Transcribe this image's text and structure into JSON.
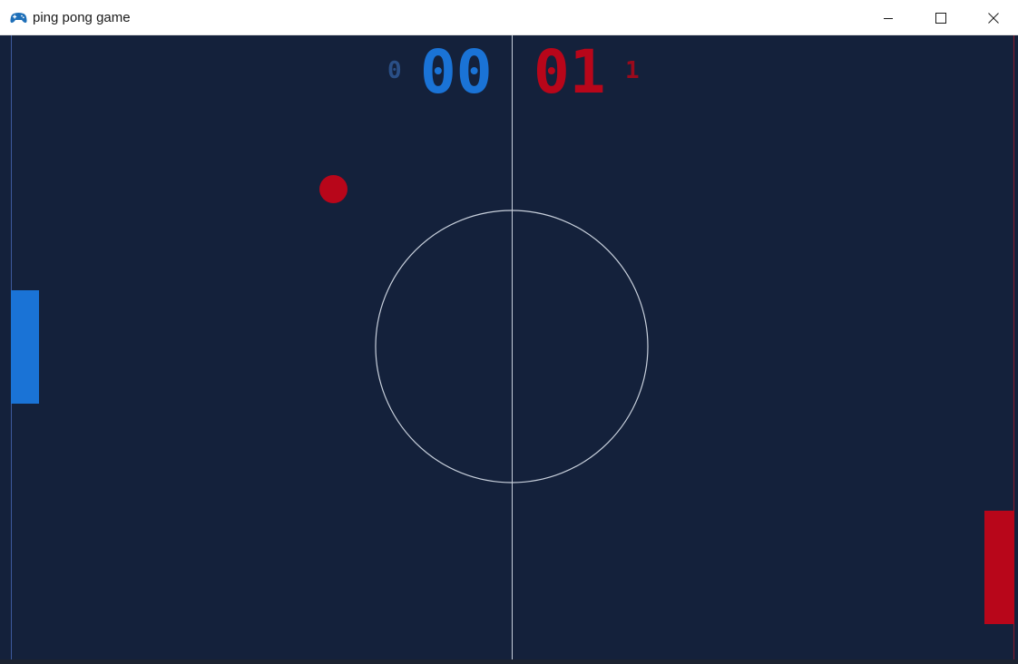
{
  "window": {
    "title": "ping pong game",
    "icon": "gamepad-icon",
    "controls": {
      "minimize": "minimize-icon",
      "maximize": "maximize-icon",
      "close": "close-icon"
    }
  },
  "game": {
    "scoreboard": {
      "left_small": "0",
      "left_big": "00",
      "right_big": "01",
      "right_small": "1"
    },
    "colors": {
      "background": "#14213b",
      "left_player": "#1a73d6",
      "right_player": "#b8061a",
      "field_lines": "#c8d0dc"
    }
  }
}
